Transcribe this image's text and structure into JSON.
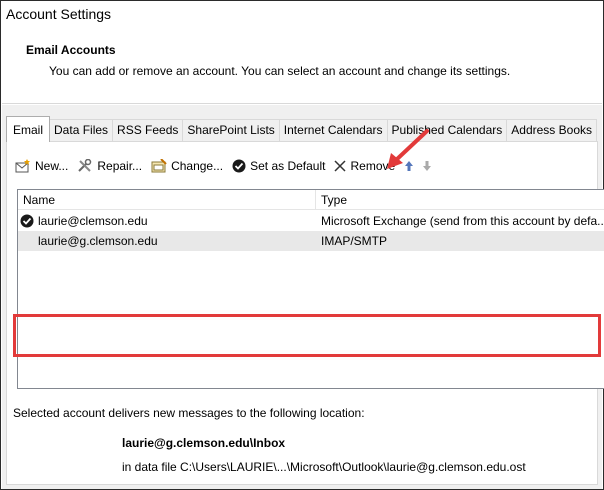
{
  "window": {
    "title": "Account Settings"
  },
  "header": {
    "heading": "Email Accounts",
    "description": "You can add or remove an account. You can select an account and change its settings."
  },
  "tabs": [
    {
      "label": "Email",
      "active": true
    },
    {
      "label": "Data Files"
    },
    {
      "label": "RSS Feeds"
    },
    {
      "label": "SharePoint Lists"
    },
    {
      "label": "Internet Calendars"
    },
    {
      "label": "Published Calendars"
    },
    {
      "label": "Address Books"
    }
  ],
  "toolbar": {
    "new_label": "New...",
    "repair_label": "Repair...",
    "change_label": "Change...",
    "set_default_label": "Set as Default",
    "remove_label": "Remove",
    "icons": [
      "new-account-icon",
      "repair-tools-icon",
      "change-icon",
      "checkmark-circle-icon",
      "remove-x-icon",
      "move-up-arrow-icon",
      "move-down-arrow-icon"
    ]
  },
  "accounts": {
    "columns": [
      "Name",
      "Type"
    ],
    "rows": [
      {
        "name": "laurie@clemson.edu",
        "type": "Microsoft Exchange (send from this account by defa...",
        "default": true
      },
      {
        "name": "laurie@g.clemson.edu",
        "type": "IMAP/SMTP",
        "default": false,
        "selected": true
      }
    ]
  },
  "delivery": {
    "text": "Selected account delivers new messages to the following location:",
    "folder": "laurie@g.clemson.edu\\Inbox",
    "data_file": "in data file C:\\Users\\LAURIE\\...\\Microsoft\\Outlook\\laurie@g.clemson.edu.ost"
  },
  "colors": {
    "annotation_red": "#e23a3a",
    "selected_row": "#e8e8e8",
    "panel_bg": "#f0f0f0"
  }
}
